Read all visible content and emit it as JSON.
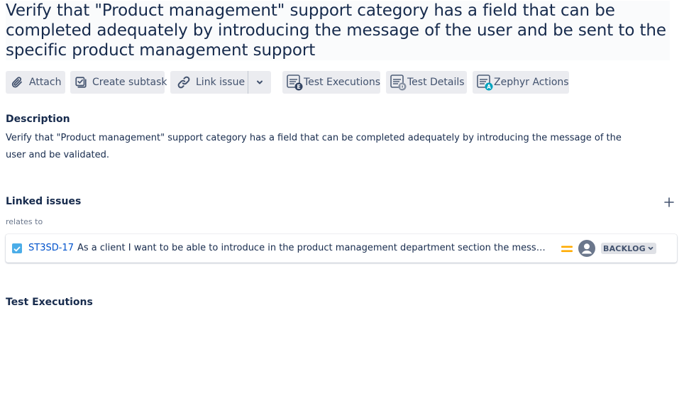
{
  "issue": {
    "title": "Verify that \"Product management\" support category has a field that can be completed adequately by introducing the message of the user and be sent to the specific product management support"
  },
  "toolbar": {
    "attach_label": "Attach",
    "create_subtask_label": "Create subtask",
    "link_issue_label": "Link issue",
    "test_executions_label": "Test Executions",
    "test_details_label": "Test Details",
    "zephyr_actions_label": "Zephyr Actions",
    "icons": {
      "attach": "paperclip-icon",
      "subtask": "subtask-icon",
      "link": "link-icon",
      "more": "chevron-down-icon",
      "test_executions": "zephyr-test-executions-icon",
      "test_details": "zephyr-test-details-icon",
      "zephyr_actions": "zephyr-actions-icon"
    }
  },
  "description": {
    "heading": "Description",
    "text": "Verify that \"Product management\" support category has a field that can be completed adequately by introducing the message of the user and be validated."
  },
  "linked_issues": {
    "heading": "Linked issues",
    "relation_label": "relates to",
    "items": [
      {
        "key": "ST3SD-17",
        "summary": "As a client I want to be able to introduce in the product management department section the message to the specific support",
        "priority": "medium",
        "priority_color": "#ffab00",
        "status": "BACKLOG"
      }
    ]
  },
  "test_executions": {
    "heading": "Test Executions"
  },
  "colors": {
    "text": "#172b4d",
    "button_bg": "#ebecf0",
    "link": "#0052cc",
    "checkbox": "#4bade8"
  }
}
